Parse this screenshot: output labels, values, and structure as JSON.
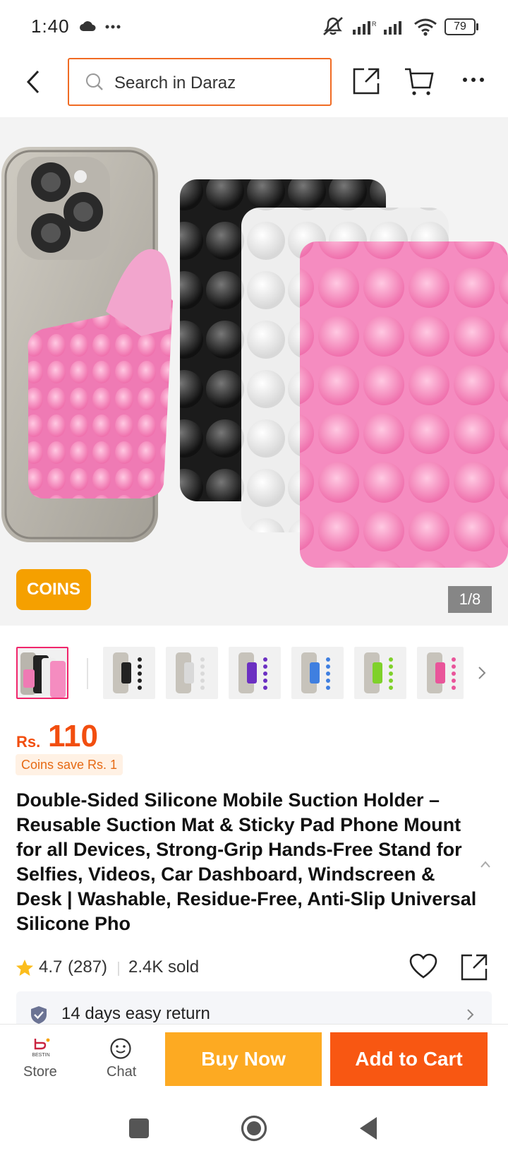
{
  "status_bar": {
    "time": "1:40",
    "battery": "79",
    "icons": [
      "cloud-icon",
      "more-dots-icon",
      "mute-icon",
      "signal-icon",
      "signal-icon",
      "wifi-icon",
      "battery-icon"
    ]
  },
  "header": {
    "search_placeholder": "Search in Daraz",
    "icons": [
      "back-arrow-icon",
      "search-icon",
      "share-icon",
      "cart-icon",
      "more-icon"
    ]
  },
  "gallery": {
    "badge": "COINS",
    "counter": "1/8",
    "thumbnail_accents": [
      "#e9559a",
      "#222222",
      "#d9d9d9",
      "#6b2fc2",
      "#3f7fe0",
      "#7fd12a",
      "#e9559a"
    ]
  },
  "product": {
    "currency": "Rs.",
    "price": "110",
    "coins_save": "Coins save Rs. 1",
    "title": "Double-Sided Silicone Mobile Suction Holder – Reusable Suction Mat & Sticky Pad Phone Mount for all Devices, Strong-Grip Hands-Free Stand for Selfies, Videos, Car Dashboard, Windscreen & Desk | Washable, Residue-Free, Anti-Slip Universal Silicone Pho",
    "rating": "4.7",
    "rating_count": "(287)",
    "sold": "2.4K sold",
    "return_policy": "14 days easy return"
  },
  "bottom_bar": {
    "store_label": "Store",
    "store_logo": "BESTIN",
    "chat_label": "Chat",
    "buy_now": "Buy Now",
    "add_to_cart": "Add to Cart"
  },
  "colors": {
    "accent": "#f85712",
    "buy_now": "#fdaa22",
    "price": "#f24e0f",
    "coins_badge": "#f5a000"
  }
}
